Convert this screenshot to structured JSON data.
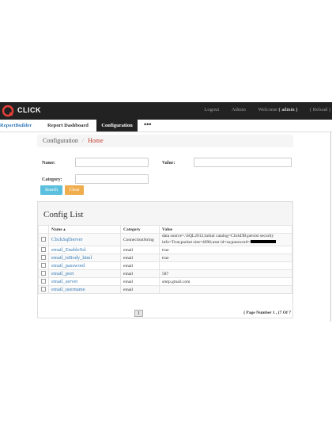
{
  "header": {
    "logo_text": "CLICK",
    "links": [
      "Logout",
      "Admin"
    ],
    "welcome": "Welcome",
    "user": "( admin )",
    "reload": "( Reload )"
  },
  "nav": {
    "brand": "ReportBuilder",
    "items": [
      "Report Dashboard",
      "Configuration"
    ],
    "more": "•••"
  },
  "breadcrumb": {
    "current": "Configuration",
    "separator": "/",
    "home": "Home"
  },
  "filters": {
    "name_label": "Name:",
    "name_value": "",
    "value_label": "Value:",
    "value_value": "",
    "category_label": "Category:",
    "category_value": "",
    "search_button": "Search",
    "clear_button": "Clear"
  },
  "config_list": {
    "title": "Config List",
    "columns": [
      "Name ▴",
      "Category",
      "Value"
    ],
    "rows": [
      {
        "name": "ClickSqlServer",
        "category": "ConnectionString",
        "value": "data source=.\\SQL2012;initial catalog=ClickDB;persist security info=True;packet size=4096;user id=sa;password="
      },
      {
        "name": "email_EnableSsl",
        "category": "email",
        "value": "true"
      },
      {
        "name": "email_isBody_html",
        "category": "email",
        "value": "true"
      },
      {
        "name": "email_password",
        "category": "email",
        "value": ""
      },
      {
        "name": "email_port",
        "category": "email",
        "value": "587"
      },
      {
        "name": "email_server",
        "category": "email",
        "value": "smtp.gmail.com"
      },
      {
        "name": "email_username",
        "category": "email",
        "value": ""
      }
    ],
    "page_button": "1",
    "page_info": "( Page Number 1 , (7 Of 7"
  },
  "colors": {
    "topbar": "#222222",
    "link": "#337ab7",
    "search": "#5bc0de",
    "clear": "#f0ad4e",
    "breadcrumb_home": "#c0392b"
  }
}
